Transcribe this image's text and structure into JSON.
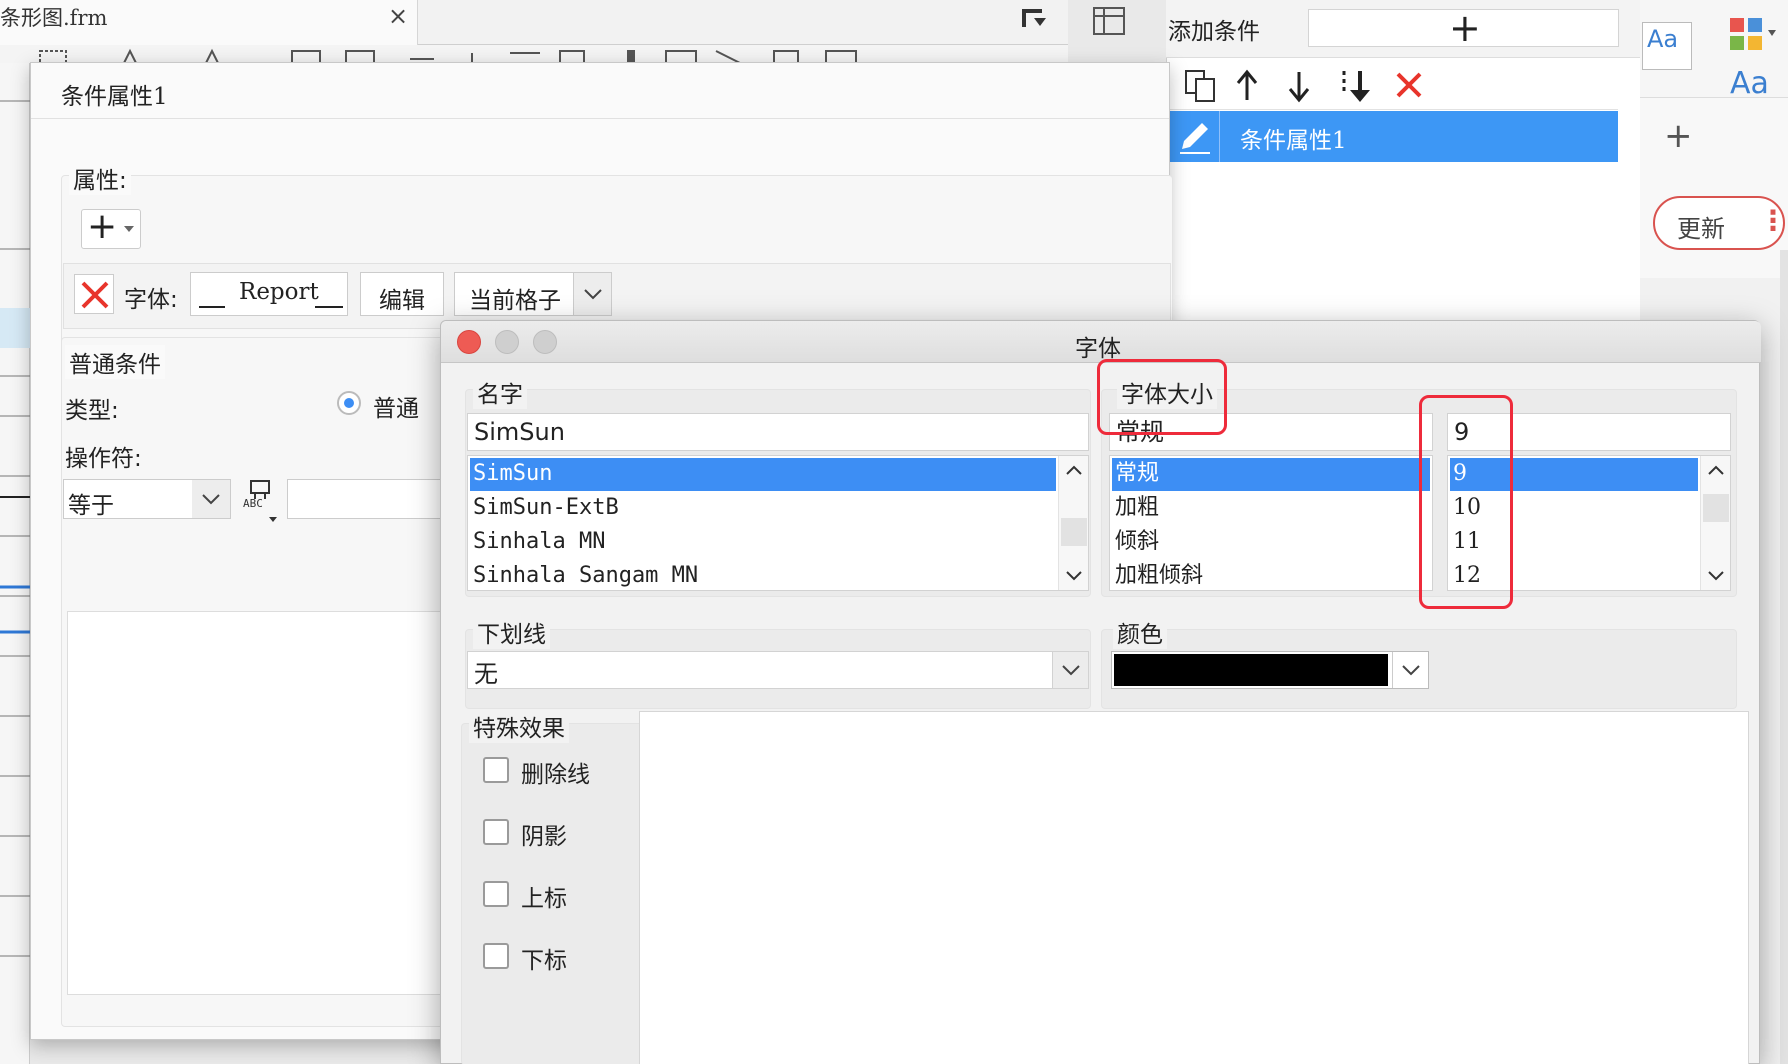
{
  "background_app": {
    "tab_title": "条形图.frm",
    "tab_close": "×"
  },
  "condition_panel": {
    "add_condition_label": "添加条件",
    "add_button_symbol": "+",
    "items": [
      {
        "label": "条件属性1",
        "selected": true
      }
    ]
  },
  "right_strip": {
    "update_button": "更新",
    "aa_label": "Aa",
    "add_symbol": "+"
  },
  "main_dialog": {
    "title": "条件属性1",
    "properties_label": "属性:",
    "add_property_symbol": "+",
    "font_row": {
      "label": "字体:",
      "preview_text": "Report",
      "edit_button": "编辑",
      "scope_select": "当前格子"
    },
    "normal_condition": {
      "group_label": "普通条件",
      "type_label": "类型:",
      "type_option": "普通",
      "operator_label": "操作符:",
      "operator_value": "等于",
      "abc_label": "ABC"
    }
  },
  "font_dialog": {
    "title": "字体",
    "name_label": "名字",
    "name_value": "SimSun",
    "name_list": [
      "SimSun",
      "SimSun-ExtB",
      "Sinhala MN",
      "Sinhala Sangam MN"
    ],
    "name_selected_index": 0,
    "size_group_label": "字体大小",
    "style_value": "常规",
    "style_list": [
      "常规",
      "加粗",
      "倾斜",
      "加粗倾斜"
    ],
    "style_selected_index": 0,
    "size_value": "9",
    "size_list": [
      "9",
      "10",
      "11",
      "12"
    ],
    "size_selected_index": 0,
    "underline_label": "下划线",
    "underline_value": "无",
    "color_label": "颜色",
    "color_value": "#000000",
    "effects_label": "特殊效果",
    "effects": [
      {
        "label": "删除线",
        "checked": false
      },
      {
        "label": "阴影",
        "checked": false
      },
      {
        "label": "上标",
        "checked": false
      },
      {
        "label": "下标",
        "checked": false
      }
    ]
  },
  "colors": {
    "selection_blue": "#3d8ef4",
    "highlight_red": "#ee2b3b",
    "delete_red": "#e8342b"
  }
}
